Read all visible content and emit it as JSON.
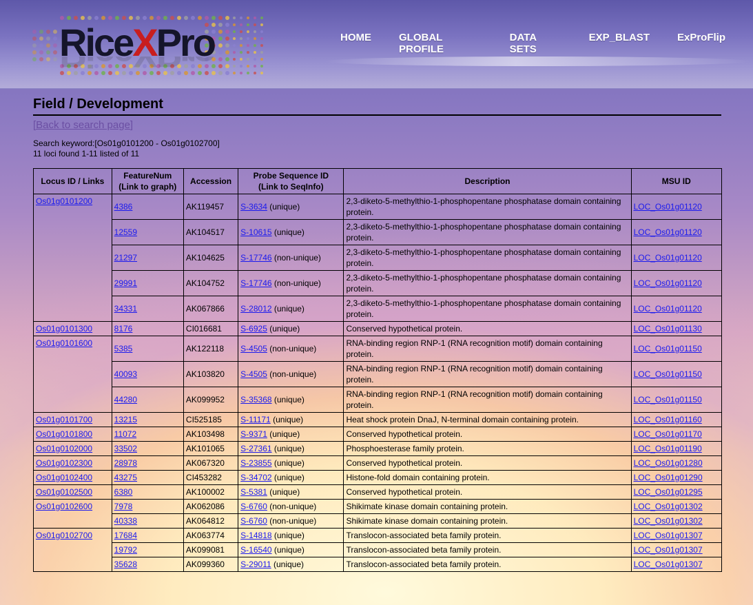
{
  "header": {
    "logo": {
      "part1": "Rice",
      "part2": "X",
      "part3": "Pro"
    },
    "nav": [
      "HOME",
      "GLOBAL PROFILE",
      "DATA SETS",
      "EXP_BLAST",
      "ExProFlip"
    ]
  },
  "page": {
    "title": "Field / Development",
    "back_link": "[Back to search page]",
    "search_keyword": "Search keyword:[Os01g0101200 - Os01g0102700]",
    "count_text": "11 loci found 1-11 listed of 11"
  },
  "table": {
    "headers": {
      "locus": "Locus ID / Links",
      "feature_l1": "FeatureNum",
      "feature_l2": "(Link to graph)",
      "accession": "Accession",
      "probe_l1": "Probe Sequence ID",
      "probe_l2": "(Link to SeqInfo)",
      "description": "Description",
      "msu": "MSU ID"
    },
    "groups": [
      {
        "locus": "Os01g0101200",
        "rows": [
          {
            "feature": "4386",
            "accession": "AK119457",
            "probe": "S-3634",
            "probe_note": " (unique)",
            "description": "2,3-diketo-5-methylthio-1-phosphopentane phosphatase domain containing protein.",
            "msu": "LOC_Os01g01120"
          },
          {
            "feature": "12559",
            "accession": "AK104517",
            "probe": "S-10615",
            "probe_note": " (unique)",
            "description": "2,3-diketo-5-methylthio-1-phosphopentane phosphatase domain containing protein.",
            "msu": "LOC_Os01g01120"
          },
          {
            "feature": "21297",
            "accession": "AK104625",
            "probe": "S-17746",
            "probe_note": " (non-unique)",
            "description": "2,3-diketo-5-methylthio-1-phosphopentane phosphatase domain containing protein.",
            "msu": "LOC_Os01g01120"
          },
          {
            "feature": "29991",
            "accession": "AK104752",
            "probe": "S-17746",
            "probe_note": " (non-unique)",
            "description": "2,3-diketo-5-methylthio-1-phosphopentane phosphatase domain containing protein.",
            "msu": "LOC_Os01g01120"
          },
          {
            "feature": "34331",
            "accession": "AK067866",
            "probe": "S-28012",
            "probe_note": " (unique)",
            "description": "2,3-diketo-5-methylthio-1-phosphopentane phosphatase domain containing protein.",
            "msu": "LOC_Os01g01120"
          }
        ]
      },
      {
        "locus": "Os01g0101300",
        "rows": [
          {
            "feature": "8176",
            "accession": "CI016681",
            "probe": "S-6925",
            "probe_note": " (unique)",
            "description": "Conserved hypothetical protein.",
            "msu": "LOC_Os01g01130"
          }
        ]
      },
      {
        "locus": "Os01g0101600",
        "rows": [
          {
            "feature": "5385",
            "accession": "AK122118",
            "probe": "S-4505",
            "probe_note": " (non-unique)",
            "description": "RNA-binding region RNP-1 (RNA recognition motif) domain containing protein.",
            "msu": "LOC_Os01g01150"
          },
          {
            "feature": "40093",
            "accession": "AK103820",
            "probe": "S-4505",
            "probe_note": " (non-unique)",
            "description": "RNA-binding region RNP-1 (RNA recognition motif) domain containing protein.",
            "msu": "LOC_Os01g01150"
          },
          {
            "feature": "44280",
            "accession": "AK099952",
            "probe": "S-35368",
            "probe_note": " (unique)",
            "description": "RNA-binding region RNP-1 (RNA recognition motif) domain containing protein.",
            "msu": "LOC_Os01g01150"
          }
        ]
      },
      {
        "locus": "Os01g0101700",
        "rows": [
          {
            "feature": "13215",
            "accession": "CI525185",
            "probe": "S-11171",
            "probe_note": " (unique)",
            "description": "Heat shock protein DnaJ, N-terminal domain containing protein.",
            "msu": "LOC_Os01g01160"
          }
        ]
      },
      {
        "locus": "Os01g0101800",
        "rows": [
          {
            "feature": "11072",
            "accession": "AK103498",
            "probe": "S-9371",
            "probe_note": " (unique)",
            "description": "Conserved hypothetical protein.",
            "msu": "LOC_Os01g01170"
          }
        ]
      },
      {
        "locus": "Os01g0102000",
        "rows": [
          {
            "feature": "33502",
            "accession": "AK101065",
            "probe": "S-27361",
            "probe_note": " (unique)",
            "description": "Phosphoesterase family protein.",
            "msu": "LOC_Os01g01190"
          }
        ]
      },
      {
        "locus": "Os01g0102300",
        "rows": [
          {
            "feature": "28978",
            "accession": "AK067320",
            "probe": "S-23855",
            "probe_note": " (unique)",
            "description": "Conserved hypothetical protein.",
            "msu": "LOC_Os01g01280"
          }
        ]
      },
      {
        "locus": "Os01g0102400",
        "rows": [
          {
            "feature": "43275",
            "accession": "CI453282",
            "probe": "S-34702",
            "probe_note": " (unique)",
            "description": "Histone-fold domain containing protein.",
            "msu": "LOC_Os01g01290"
          }
        ]
      },
      {
        "locus": "Os01g0102500",
        "rows": [
          {
            "feature": "6380",
            "accession": "AK100002",
            "probe": "S-5381",
            "probe_note": " (unique)",
            "description": "Conserved hypothetical protein.",
            "msu": "LOC_Os01g01295"
          }
        ]
      },
      {
        "locus": "Os01g0102600",
        "rows": [
          {
            "feature": "7978",
            "accession": "AK062086",
            "probe": "S-6760",
            "probe_note": " (non-unique)",
            "description": "Shikimate kinase domain containing protein.",
            "msu": "LOC_Os01g01302"
          },
          {
            "feature": "40338",
            "accession": "AK064812",
            "probe": "S-6760",
            "probe_note": " (non-unique)",
            "description": "Shikimate kinase domain containing protein.",
            "msu": "LOC_Os01g01302"
          }
        ]
      },
      {
        "locus": "Os01g0102700",
        "rows": [
          {
            "feature": "17684",
            "accession": "AK063774",
            "probe": "S-14818",
            "probe_note": " (unique)",
            "description": "Translocon-associated beta family protein.",
            "msu": "LOC_Os01g01307"
          },
          {
            "feature": "19792",
            "accession": "AK099081",
            "probe": "S-16540",
            "probe_note": " (unique)",
            "description": "Translocon-associated beta family protein.",
            "msu": "LOC_Os01g01307"
          },
          {
            "feature": "35628",
            "accession": "AK099360",
            "probe": "S-29011",
            "probe_note": " (unique)",
            "description": "Translocon-associated beta family protein.",
            "msu": "LOC_Os01g01307"
          }
        ]
      }
    ]
  },
  "colors": {
    "link": "#1a1aee",
    "visited_link": "#6b4fa3",
    "logo_x": "#c81e1e"
  }
}
